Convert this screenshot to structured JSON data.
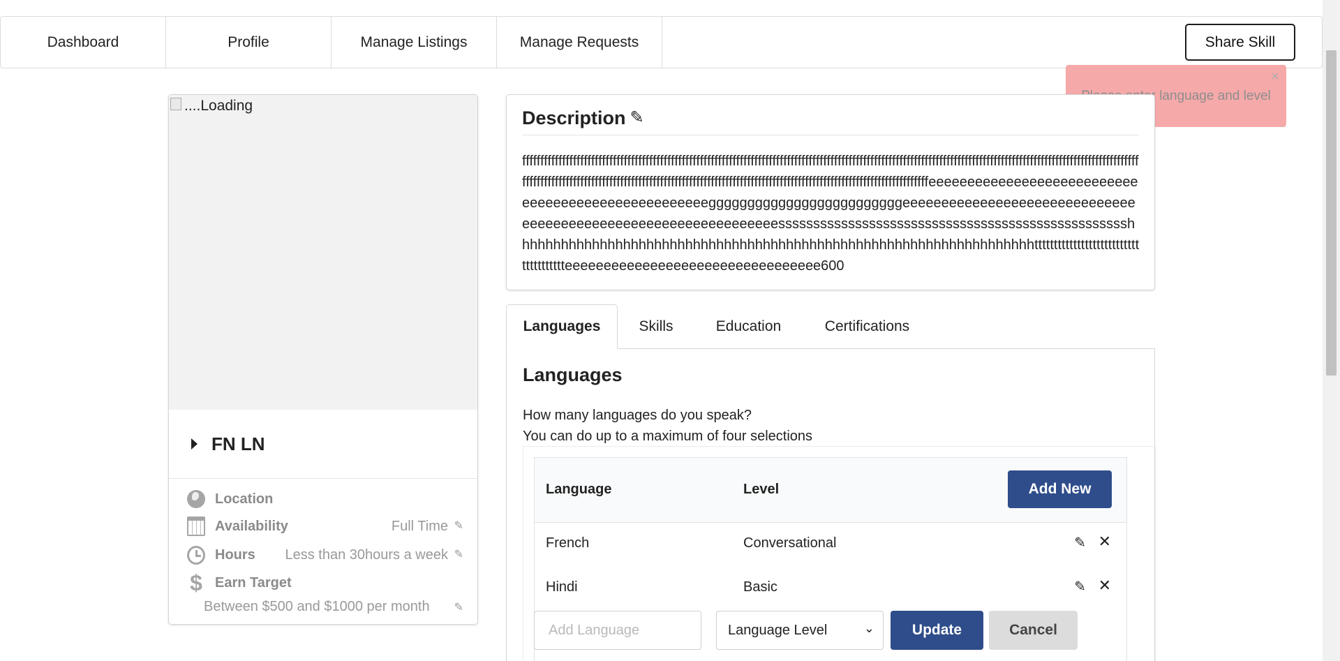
{
  "nav": {
    "items": [
      "Dashboard",
      "Profile",
      "Manage Listings",
      "Manage Requests"
    ],
    "share_label": "Share Skill"
  },
  "toast": {
    "message": "Please enter language and level",
    "close": "×"
  },
  "profile": {
    "image_alt": "....Loading",
    "name": "FN LN",
    "details": {
      "location_label": "Location",
      "availability_label": "Availability",
      "availability_value": "Full Time",
      "hours_label": "Hours",
      "hours_value": "Less than 30hours a week",
      "earn_label": "Earn Target",
      "earn_value": "Between $500 and $1000 per month"
    }
  },
  "description": {
    "title": "Description",
    "text": "ffffffffffffffffffffffffffffffffffffffffffffffffffffffffffffffffffffffffffffffffffffffffffffffffffffffffffffffffffffffffffffffffffffffffffffffffffffffffffffffffffffffffffffffffffffffffffffffffffffffffffffffffffffffffffffffffffffffffffffffffffffffffffffffffffffffffffffffffffffffffffeeeeeeeeeeeeeeeeeeeeeeeeeeeeeeeeeeeeeeeeeeeeeeeeeeegggggggggggggggggggggggggeeeeeeeeeeeeeeeeeeeeeeeeeeeeeeeeeeeeeeeeeeeeeeeeeeeeeeeeeeeeeeesssssssssssssssssssssssssssssssssssssssssssssssssshhhhhhhhhhhhhhhhhhhhhhhhhhhhhhhhhhhhhhhhhhhhhhhhhhhhhhhhhhhhhhhhhhhtttttttttttttttttttttttttttttttttttttteeeeeeeeeeeeeeeeeeeeeeeeeeeeeeeee600"
  },
  "tabs": [
    "Languages",
    "Skills",
    "Education",
    "Certifications"
  ],
  "languages": {
    "title": "Languages",
    "question": "How many languages do you speak?",
    "note": "You can do up to a maximum of four selections",
    "col_language": "Language",
    "col_level": "Level",
    "add_new_label": "Add New",
    "rows": [
      {
        "language": "French",
        "level": "Conversational"
      },
      {
        "language": "Hindi",
        "level": "Basic"
      }
    ],
    "form": {
      "input_placeholder": "Add Language",
      "select_value": "Language Level",
      "update_label": "Update",
      "cancel_label": "Cancel"
    }
  },
  "icons": {
    "edit": "pencil-icon",
    "delete": "close-icon",
    "location": "globe-icon",
    "availability": "calendar-icon",
    "hours": "clock-icon",
    "earn": "dollar-icon"
  },
  "colors": {
    "primary": "#2f4d8b",
    "toast_bg": "#f6a5a5"
  }
}
